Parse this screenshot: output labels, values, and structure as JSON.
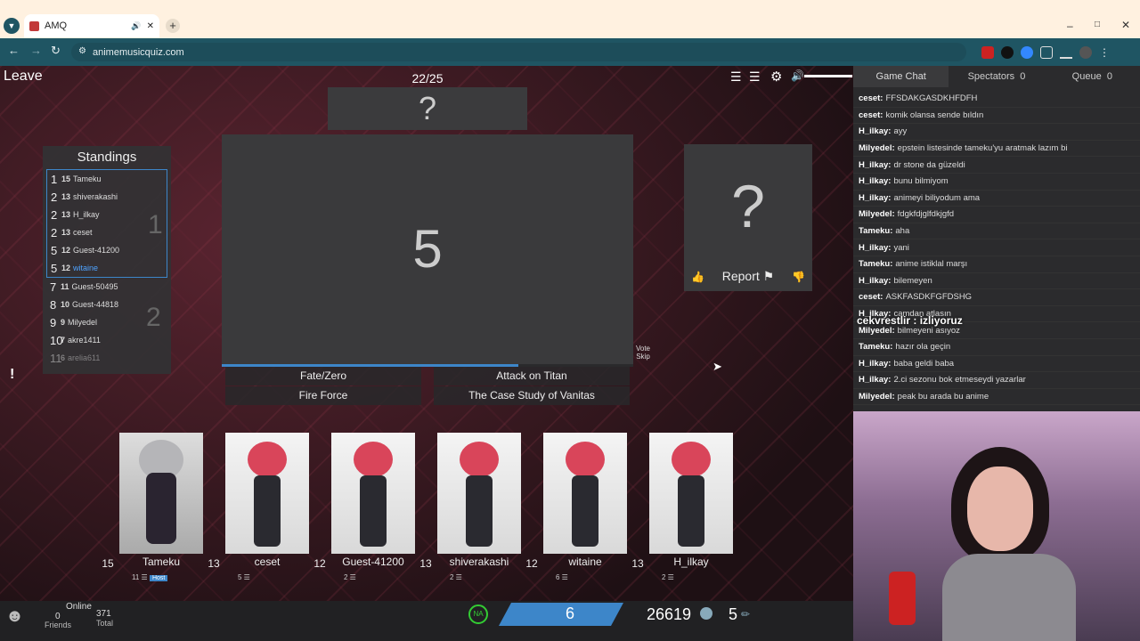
{
  "browser": {
    "tab_title": "AMQ",
    "url": "animemusicquiz.com"
  },
  "game": {
    "leave": "Leave",
    "round": "22/25",
    "song_mark": "?",
    "countdown": "5",
    "info_mark": "?",
    "report": "Report",
    "vote_skip": "Vote Skip",
    "progress": 0.72,
    "standings_title": "Standings",
    "group_1": "1",
    "group_2": "2",
    "standings": [
      {
        "pos": "1",
        "score": "15",
        "name": "Tameku"
      },
      {
        "pos": "2",
        "score": "13",
        "name": "shiverakashi"
      },
      {
        "pos": "2",
        "score": "13",
        "name": "H_ilkay"
      },
      {
        "pos": "2",
        "score": "13",
        "name": "ceset"
      },
      {
        "pos": "5",
        "score": "12",
        "name": "Guest-41200"
      },
      {
        "pos": "5",
        "score": "12",
        "name": "witaine"
      },
      {
        "pos": "7",
        "score": "11",
        "name": "Guest-50495"
      },
      {
        "pos": "8",
        "score": "10",
        "name": "Guest-44818"
      },
      {
        "pos": "9",
        "score": "9",
        "name": "Milyedel"
      },
      {
        "pos": "10",
        "score": "7",
        "name": "akre1411"
      },
      {
        "pos": "11",
        "score": "6",
        "name": "arelia611"
      }
    ],
    "answers": [
      "Fate/Zero",
      "Attack on Titan",
      "Fire Force",
      "The Case Study of Vanitas"
    ],
    "players": [
      {
        "score": "15",
        "name": "Tameku",
        "sub": "11",
        "badge": "Host"
      },
      {
        "score": "13",
        "name": "ceset",
        "sub": "5"
      },
      {
        "score": "12",
        "name": "Guest-41200",
        "sub": "2"
      },
      {
        "score": "13",
        "name": "shiverakashi",
        "sub": "2"
      },
      {
        "score": "12",
        "name": "witaine",
        "sub": "6"
      },
      {
        "score": "13",
        "name": "H_ilkay",
        "sub": "2"
      }
    ]
  },
  "footer": {
    "online_label": "Online",
    "friends_count": "0",
    "friends_label": "Friends",
    "total_count": "371",
    "total_label": "Total",
    "region": "NA",
    "level": "6",
    "points": "26619",
    "tickets": "5"
  },
  "chat": {
    "tab_chat": "Game Chat",
    "tab_spectators": "Spectators",
    "spectators_count": "0",
    "tab_queue": "Queue",
    "queue_count": "0",
    "overlay_text": "cekvrestlir : izliyoruz",
    "messages": [
      {
        "user": "ceset:",
        "text": "FFSDAKGASDKHFDFH"
      },
      {
        "user": "ceset:",
        "text": "komik olansa sende bıldın"
      },
      {
        "user": "H_ilkay:",
        "text": "ayy"
      },
      {
        "user": "Milyedel:",
        "text": "epstein listesinde tameku'yu aratmak lazım bi"
      },
      {
        "user": "H_ilkay:",
        "text": "dr stone da güzeldi"
      },
      {
        "user": "H_ilkay:",
        "text": "bunu bilmiyom"
      },
      {
        "user": "H_ilkay:",
        "text": "animeyi biliyodum ama"
      },
      {
        "user": "Milyedel:",
        "text": "fdgkfdjglfdkjgfd"
      },
      {
        "user": "Tameku:",
        "text": "aha"
      },
      {
        "user": "H_ilkay:",
        "text": "yani"
      },
      {
        "user": "Tameku:",
        "text": "anime istiklal marşı"
      },
      {
        "user": "H_ilkay:",
        "text": "bilemeyen"
      },
      {
        "user": "ceset:",
        "text": "ASKFASDKFGFDSHG"
      },
      {
        "user": "H_ilkay:",
        "text": "camdan atlasın"
      },
      {
        "user": "Milyedel:",
        "text": "bilmeyeni asıyoz"
      },
      {
        "user": "Tameku:",
        "text": "hazır ola geçin"
      },
      {
        "user": "H_ilkay:",
        "text": "baba geldi baba"
      },
      {
        "user": "H_ilkay:",
        "text": "2.ci sezonu bok etmeseydi yazarlar"
      },
      {
        "user": "Milyedel:",
        "text": "peak bu arada bu anime"
      }
    ]
  },
  "colors": {
    "accent": "#3d86c9",
    "chrome": "#1f5563",
    "highlight": "#4fa3ff"
  }
}
